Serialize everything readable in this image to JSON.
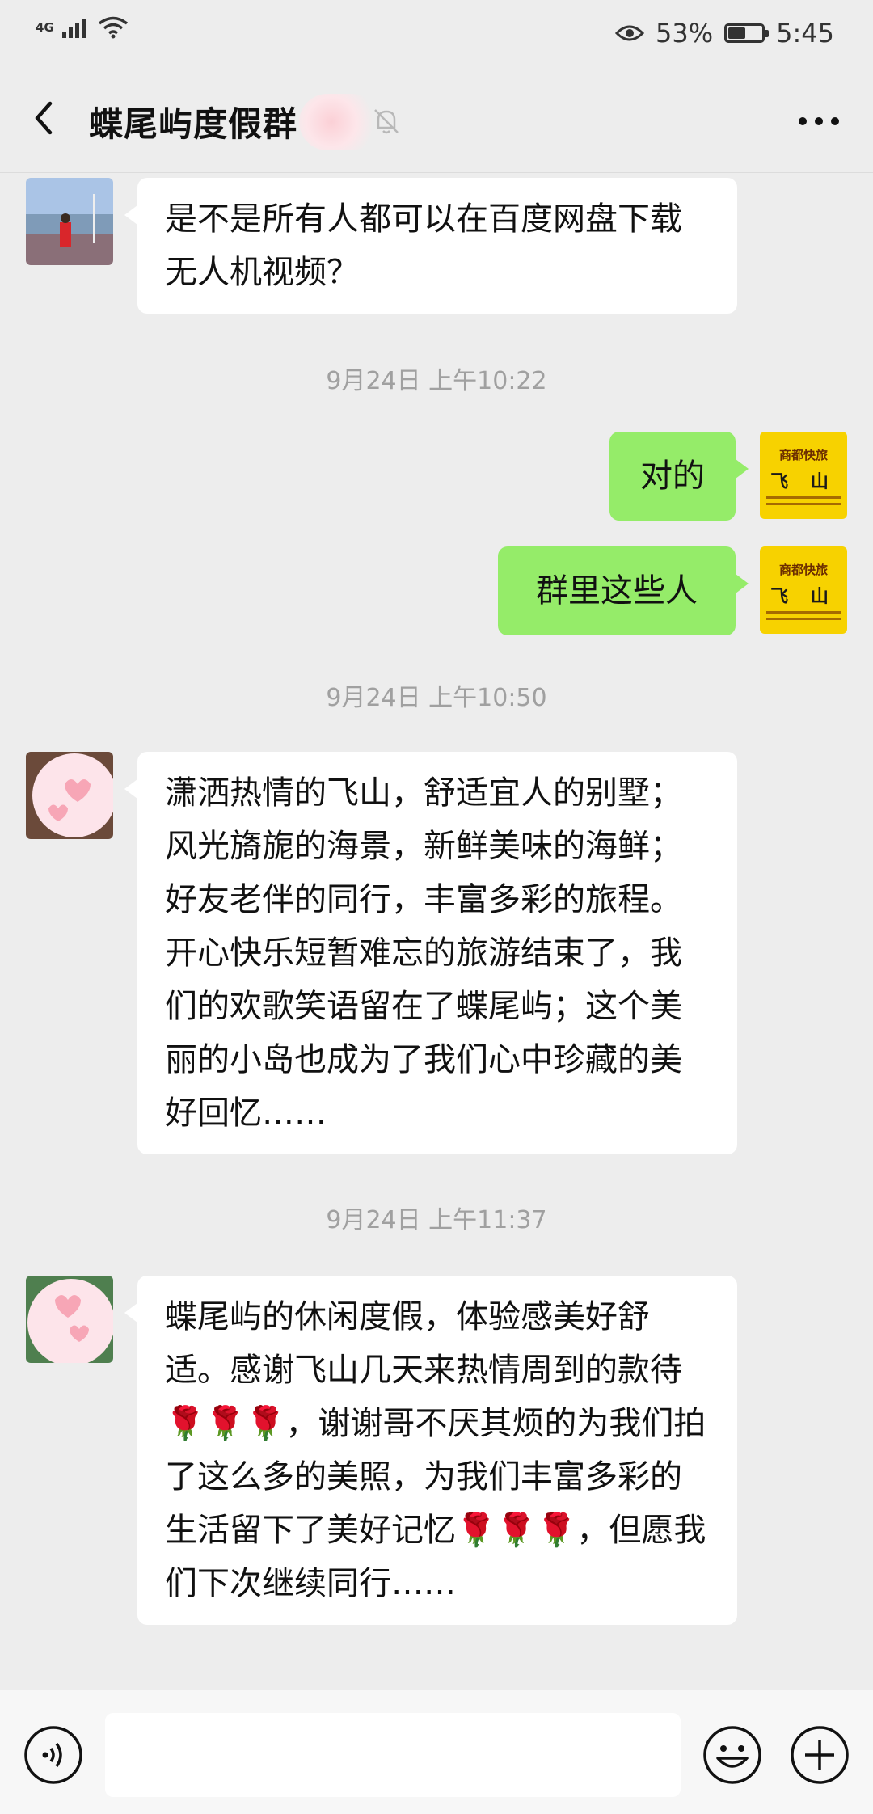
{
  "status_bar": {
    "network": "4G",
    "battery_percent": "53%",
    "battery_level": 0.53,
    "time": "5:45"
  },
  "header": {
    "title": "蝶尾屿度假群",
    "back_icon": "back-arrow-icon",
    "mute_icon": "bell-muted-icon",
    "more_icon": "more-dots-icon"
  },
  "messages": [
    {
      "type": "incoming",
      "text": "是不是所有人都可以在百度网盘下载无人机视频？"
    },
    {
      "type": "timestamp",
      "text": "9月24日 上午10:22"
    },
    {
      "type": "outgoing",
      "text": "对的"
    },
    {
      "type": "outgoing",
      "text": "群里这些人"
    },
    {
      "type": "timestamp",
      "text": "9月24日 上午10:50"
    },
    {
      "type": "incoming",
      "text": "潇洒热情的飞山，舒适宜人的别墅；风光旖旎的海景，新鲜美味的海鲜；好友老伴的同行，丰富多彩的旅程。开心快乐短暂难忘的旅游结束了，我们的欢歌笑语留在了蝶尾屿；这个美丽的小岛也成为了我们心中珍藏的美好回忆……"
    },
    {
      "type": "timestamp",
      "text": "9月24日 上午11:37"
    },
    {
      "type": "incoming",
      "text": "蝶尾屿的休闲度假，体验感美好舒适。感谢飞山几天来热情周到的款待🌹🌹🌹，谢谢哥不厌其烦的为我们拍了这么多的美照，为我们丰富多彩的生活留下了美好记忆🌹🌹🌹，但愿我们下次继续同行……"
    }
  ],
  "my_avatar": {
    "line1": "商都快旅",
    "line2": "飞 山"
  },
  "input_bar": {
    "voice_icon": "voice-icon",
    "emoji_icon": "emoji-icon",
    "plus_icon": "plus-icon"
  },
  "colors": {
    "background": "#ededed",
    "outgoing_bubble": "#95ec69",
    "incoming_bubble": "#ffffff",
    "timestamp": "#a0a0a0"
  }
}
